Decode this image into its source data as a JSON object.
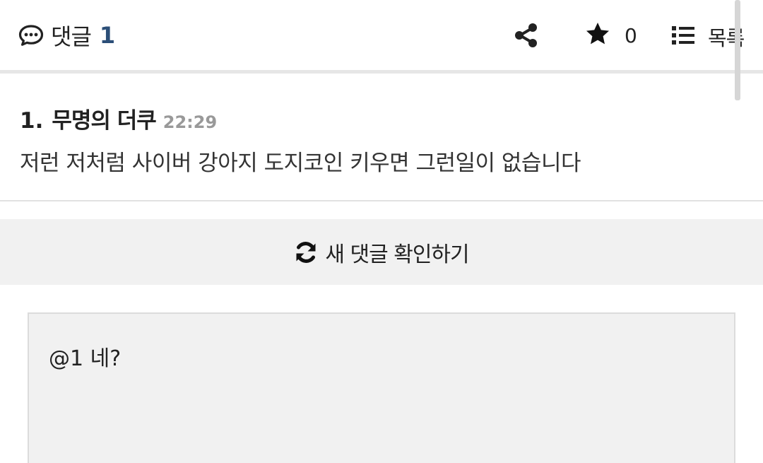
{
  "header": {
    "title": "댓글",
    "count": "1",
    "star_count": "0",
    "list_label": "목록"
  },
  "comments": [
    {
      "number": "1.",
      "author": "무명의 더쿠",
      "time": "22:29",
      "body": "저런 저처럼 사이버 강아지 도지코인 키우면 그런일이 없습니다"
    }
  ],
  "refresh": {
    "label": "새 댓글 확인하기"
  },
  "reply": {
    "value": "@1 네?"
  },
  "icons": {
    "comment": "speech-bubble-icon",
    "share": "share-icon",
    "star": "star-icon",
    "list": "list-icon",
    "refresh": "refresh-icon"
  },
  "colors": {
    "count_accent": "#2c4f78",
    "time_gray": "#999999",
    "bar_bg": "#f1f1f1"
  }
}
